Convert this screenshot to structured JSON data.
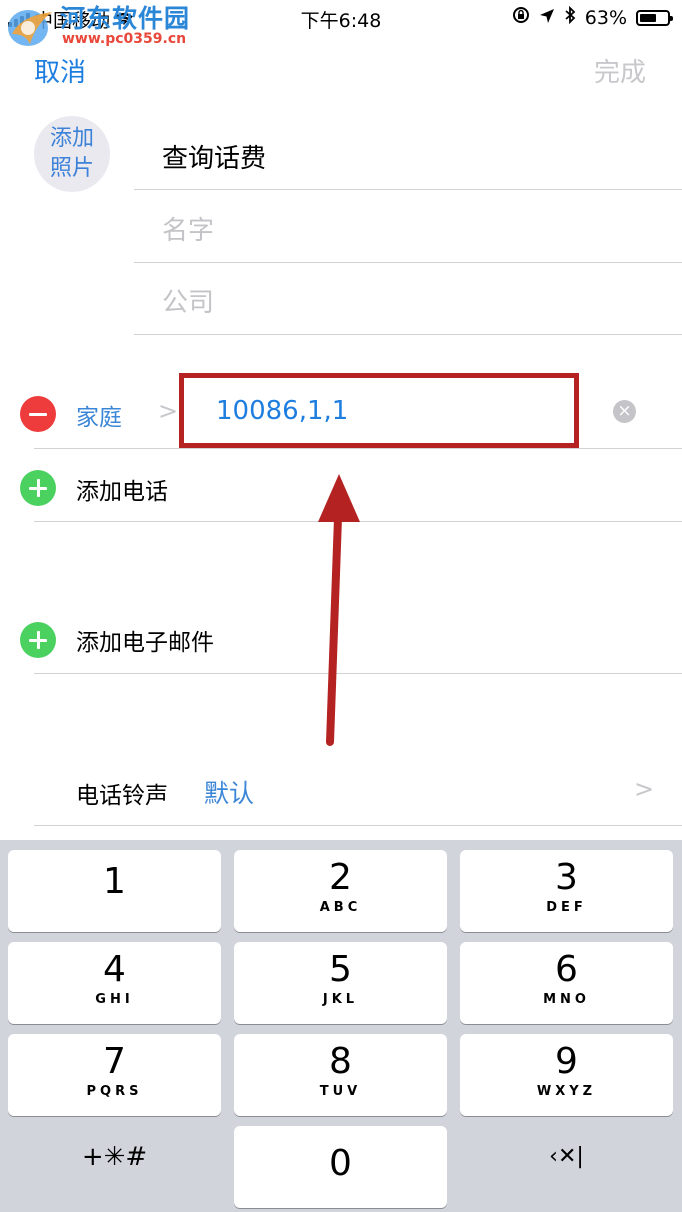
{
  "status_bar": {
    "carrier": "中国移动",
    "time": "下午6:48",
    "battery": "63%",
    "battery_level": 0.63
  },
  "watermark": {
    "name": "河东软件园",
    "url": "www.pc0359.cn"
  },
  "nav": {
    "cancel": "取消",
    "done": "完成"
  },
  "photo": {
    "line1": "添加",
    "line2": "照片"
  },
  "fields": {
    "surname": "查询话费",
    "name_placeholder": "名字",
    "company_placeholder": "公司"
  },
  "phone": {
    "label": "家庭",
    "value": "10086,1,1"
  },
  "rows": {
    "add_phone": "添加电话",
    "add_email": "添加电子邮件",
    "ringtone_label": "电话铃声",
    "ringtone_value": "默认"
  },
  "keypad": {
    "keys": [
      {
        "num": "1",
        "letters": ""
      },
      {
        "num": "2",
        "letters": "ABC"
      },
      {
        "num": "3",
        "letters": "DEF"
      },
      {
        "num": "4",
        "letters": "GHI"
      },
      {
        "num": "5",
        "letters": "JKL"
      },
      {
        "num": "6",
        "letters": "MNO"
      },
      {
        "num": "7",
        "letters": "PQRS"
      },
      {
        "num": "8",
        "letters": "TUV"
      },
      {
        "num": "9",
        "letters": "WXYZ"
      },
      {
        "num": "0",
        "letters": ""
      }
    ],
    "symbols": "+✳#",
    "delete": "‹✕|"
  },
  "colors": {
    "accent": "#1e7ee0",
    "annotation": "#b52222",
    "delete_red": "#ee3b3b",
    "add_green": "#4bd160",
    "keypad_bg": "#d1d4db"
  }
}
